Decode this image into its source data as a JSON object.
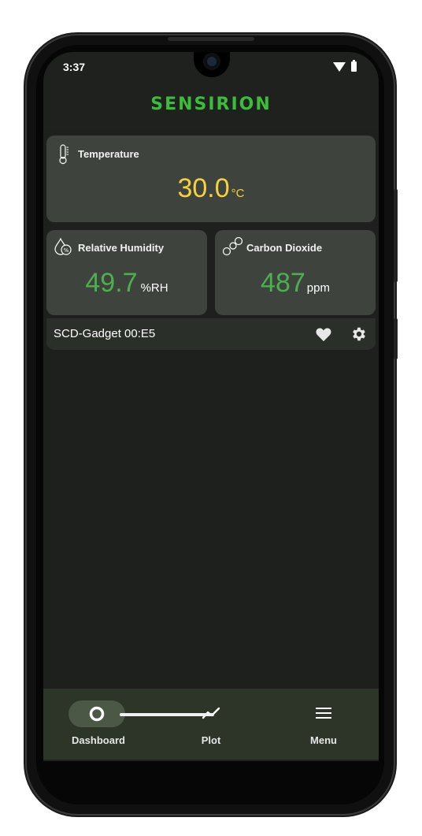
{
  "status": {
    "time": "3:37"
  },
  "app": {
    "brand": "SENSIRION"
  },
  "cards": {
    "temperature": {
      "label": "Temperature",
      "value": "30.0",
      "unit": "°C",
      "color": "#f5d140"
    },
    "humidity": {
      "label": "Relative Humidity",
      "value": "49.7",
      "unit": "%RH",
      "color": "#4caf50"
    },
    "co2": {
      "label": "Carbon Dioxide",
      "value": "487",
      "unit": "ppm",
      "color": "#4caf50"
    }
  },
  "device": {
    "name": "SCD-Gadget 00:E5",
    "icons": [
      "heart-icon",
      "gear-icon"
    ]
  },
  "nav": {
    "items": [
      {
        "label": "Dashboard",
        "icon": "circle-icon",
        "active": true
      },
      {
        "label": "Plot",
        "icon": "line-chart-icon"
      },
      {
        "label": "Menu",
        "icon": "hamburger-menu-icon"
      }
    ]
  },
  "colors": {
    "accent": "#3bbc3b",
    "background": "#1e211d",
    "card": "#3e443d",
    "nav": "#2c3528"
  }
}
